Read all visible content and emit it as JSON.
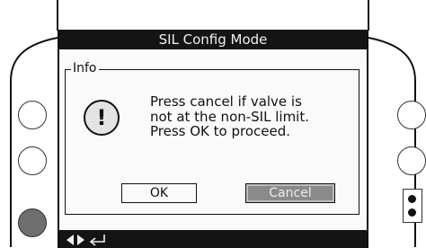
{
  "screen": {
    "title": "SIL Config Mode"
  },
  "info_box": {
    "label": "Info",
    "icon": "exclamation-icon",
    "message_lines": [
      "Press cancel if valve is",
      "not at the non-SIL limit.",
      "Press OK to proceed."
    ]
  },
  "buttons": {
    "ok_label": "OK",
    "cancel_label": "Cancel"
  },
  "footer": {
    "icons": [
      "left-right-arrows-icon",
      "enter-return-icon"
    ]
  },
  "hardware": {
    "left_buttons": [
      "side-button-1",
      "side-button-2",
      "side-button-3"
    ],
    "right_buttons": [
      "side-button-4",
      "side-button-5"
    ],
    "selector": "two-position-selector"
  },
  "colors": {
    "title_bar": "#141414",
    "screen_bg": "#fafafa",
    "cancel_button_bg": "#8a8a8a",
    "left_button_3_fill": "#6e6e6e"
  }
}
